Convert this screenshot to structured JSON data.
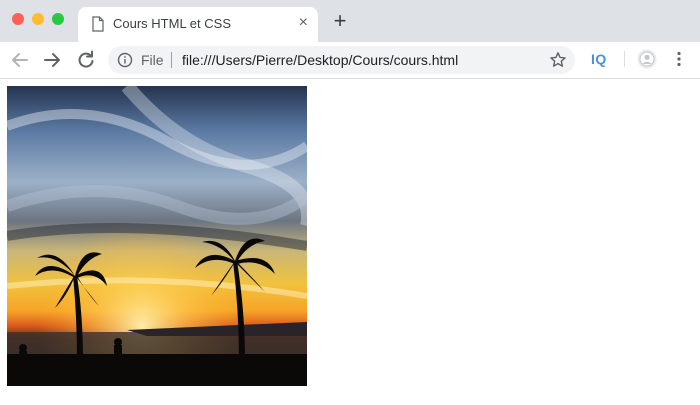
{
  "window": {
    "controls": [
      "close-icon",
      "minimize-icon",
      "maximize-icon"
    ]
  },
  "tab": {
    "title": "Cours HTML et CSS",
    "icon": "document-icon",
    "close_glyph": "×"
  },
  "newtab": {
    "glyph": "+"
  },
  "toolbar": {
    "back_icon": "arrow-left-icon",
    "forward_icon": "arrow-right-icon",
    "reload_icon": "reload-icon",
    "omnibox": {
      "scheme_label": "File",
      "url": "file:///Users/Pierre/Desktop/Cours/cours.html",
      "info_icon": "info-icon",
      "bookmark_icon": "star-icon"
    },
    "extension_label": "IQ",
    "profile_icon": "avatar-icon",
    "menu_icon": "kebab-menu-icon"
  },
  "page": {
    "image": {
      "subject": "sunset-palm-trees-photo"
    }
  },
  "colors": {
    "tabstrip_bg": "#dee1e6",
    "omnibox_bg": "#f1f3f4",
    "extension_accent": "#4a90d9"
  }
}
